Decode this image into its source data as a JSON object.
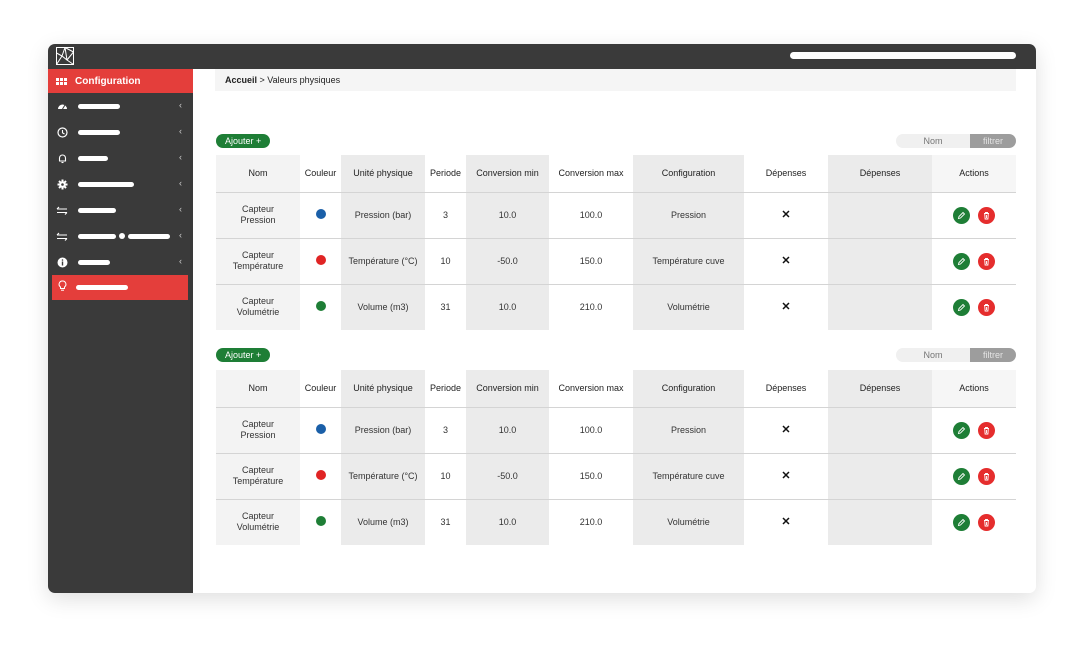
{
  "sidebar": {
    "active_label": "Configuration",
    "items": [
      {
        "icon": "dashboard-icon"
      },
      {
        "icon": "clock-icon"
      },
      {
        "icon": "bell-icon"
      },
      {
        "icon": "gear-icon"
      },
      {
        "icon": "transfer-icon"
      },
      {
        "icon": "transfer-icon"
      },
      {
        "icon": "info-icon"
      }
    ],
    "selected_icon": "lightbulb-icon"
  },
  "breadcrumb": {
    "home": "Accueil",
    "separator": " > ",
    "current": "Valeurs physiques"
  },
  "tables": [
    {
      "add_label": "Ajouter +",
      "filter_placeholder": "Nom",
      "filter_label": "filtrer",
      "headers": [
        "Nom",
        "Couleur",
        "Unité physique",
        "Periode",
        "Conversion min",
        "Conversion max",
        "Configuration",
        "Dépenses",
        "Dépenses",
        "Actions"
      ],
      "rows": [
        {
          "nom1": "Capteur",
          "nom2": "Pression",
          "color": "#1a5fa8",
          "unite": "Pression (bar)",
          "periode": "3",
          "cmin": "10.0",
          "cmax": "100.0",
          "config": "Pression",
          "dep1": "✕",
          "dep2": ""
        },
        {
          "nom1": "Capteur",
          "nom2": "Température",
          "color": "#e02424",
          "unite": "Température (°C)",
          "periode": "10",
          "cmin": "-50.0",
          "cmax": "150.0",
          "config": "Température cuve",
          "dep1": "✕",
          "dep2": ""
        },
        {
          "nom1": "Capteur",
          "nom2": "Volumétrie",
          "color": "#1e7e36",
          "unite": "Volume (m3)",
          "periode": "31",
          "cmin": "10.0",
          "cmax": "210.0",
          "config": "Volumétrie",
          "dep1": "✕",
          "dep2": ""
        }
      ]
    },
    {
      "add_label": "Ajouter +",
      "filter_placeholder": "Nom",
      "filter_label": "filtrer",
      "headers": [
        "Nom",
        "Couleur",
        "Unité physique",
        "Periode",
        "Conversion min",
        "Conversion max",
        "Configuration",
        "Dépenses",
        "Dépenses",
        "Actions"
      ],
      "rows": [
        {
          "nom1": "Capteur",
          "nom2": "Pression",
          "color": "#1a5fa8",
          "unite": "Pression (bar)",
          "periode": "3",
          "cmin": "10.0",
          "cmax": "100.0",
          "config": "Pression",
          "dep1": "✕",
          "dep2": ""
        },
        {
          "nom1": "Capteur",
          "nom2": "Température",
          "color": "#e02424",
          "unite": "Température (°C)",
          "periode": "10",
          "cmin": "-50.0",
          "cmax": "150.0",
          "config": "Température cuve",
          "dep1": "✕",
          "dep2": ""
        },
        {
          "nom1": "Capteur",
          "nom2": "Volumétrie",
          "color": "#1e7e36",
          "unite": "Volume (m3)",
          "periode": "31",
          "cmin": "10.0",
          "cmax": "210.0",
          "config": "Volumétrie",
          "dep1": "✕",
          "dep2": ""
        }
      ]
    }
  ]
}
